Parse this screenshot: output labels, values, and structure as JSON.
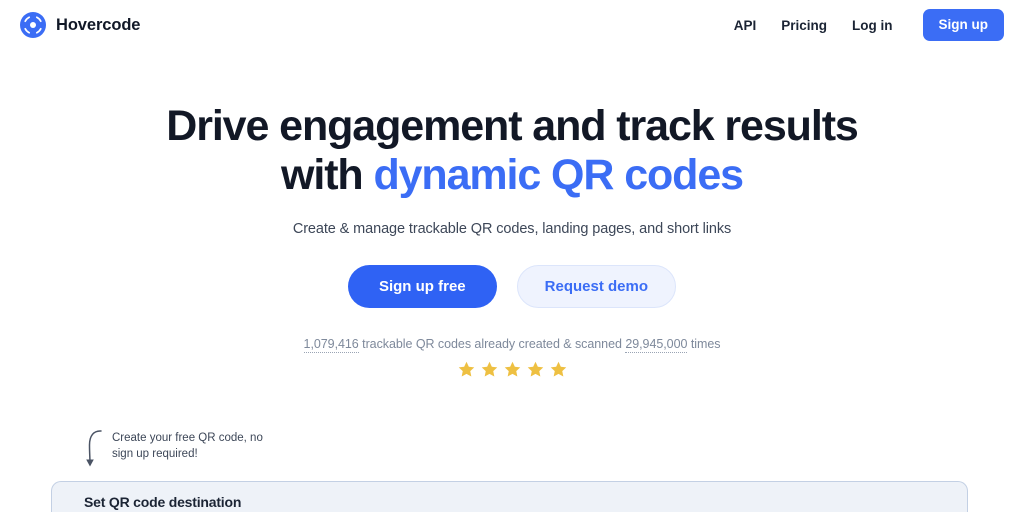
{
  "brand": {
    "name": "Hovercode",
    "logo_icon": "qr-target-icon",
    "accent_color": "#3b6df5"
  },
  "header": {
    "nav_links": [
      {
        "label": "API",
        "name": "nav-link-api"
      },
      {
        "label": "Pricing",
        "name": "nav-link-pricing"
      },
      {
        "label": "Log in",
        "name": "nav-link-login"
      }
    ],
    "signup_label": "Sign up"
  },
  "hero": {
    "headline_line1": "Drive engagement and track results",
    "headline_line2_prefix": "with ",
    "headline_line2_accent": "dynamic QR codes",
    "subheadline": "Create & manage trackable QR codes, landing pages, and short links",
    "primary_cta": "Sign up free",
    "secondary_cta": "Request demo",
    "stats": {
      "codes_created": "1,079,416",
      "mid_text": " trackable QR codes already created & scanned ",
      "scans_count": "29,945,000",
      "end_text": " times"
    },
    "rating": {
      "stars": 5,
      "star_color": "#eec042",
      "star_icon": "star-icon"
    }
  },
  "annotation": {
    "arrow_icon": "curved-down-arrow-icon",
    "text": "Create your free QR code, no sign up required!"
  },
  "builder": {
    "title": "Set QR code destination"
  }
}
